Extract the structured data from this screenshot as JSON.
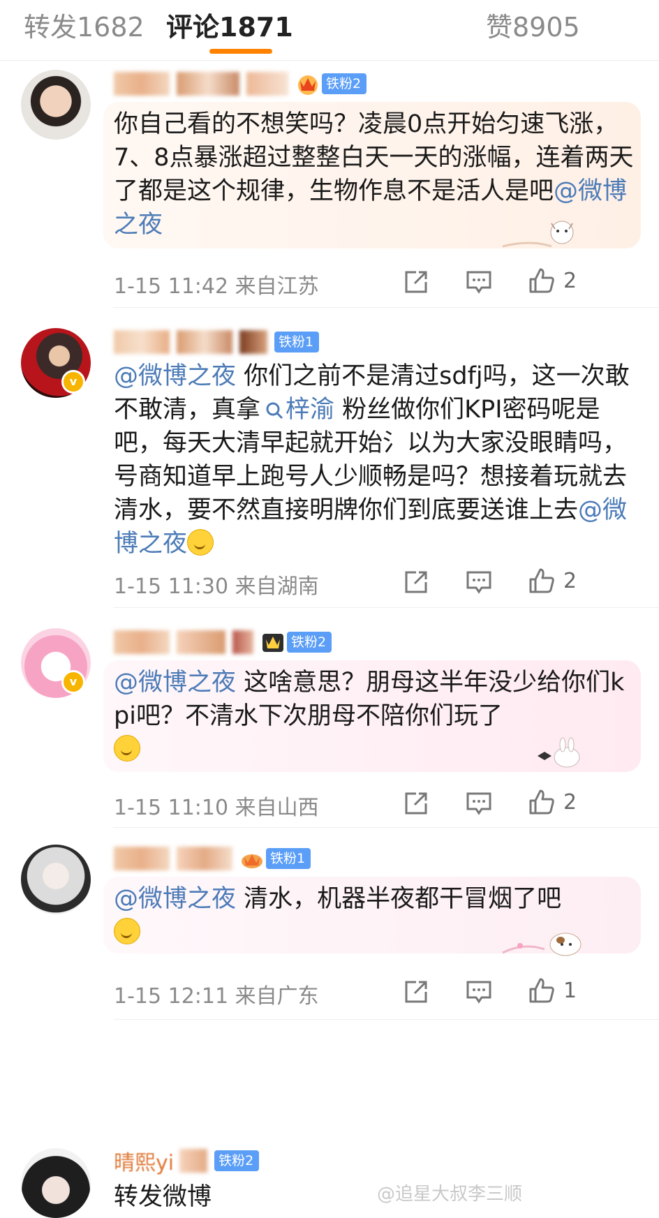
{
  "tabs": {
    "repost": "转发1682",
    "comments": "评论1871",
    "likes": "赞8905"
  },
  "colors": {
    "accent": "#ff8200",
    "mention": "#4c7bb7",
    "fan_badge": "#5b9ef7",
    "vip": "#f7b500"
  },
  "comments": [
    {
      "fan_badge": "铁粉2",
      "text": "你自己看的不想笑吗？凌晨0点开始匀速飞涨，7、8点暴涨超过整整白天一天的涨幅，连着两天了都是这个规律，生物作息不是活人是吧",
      "mention_end": "@微博之夜",
      "time": "1-15 11:42",
      "location": "来自江苏",
      "likes": "2"
    },
    {
      "fan_badge": "铁粉1",
      "mention_start": "@微博之夜",
      "text_a": " 你们之前不是清过sdfj吗，这一次敢不敢清，真拿",
      "search_link": "梓渝",
      "text_b": " 粉丝做你们KPI密码呢是吧，每天大清早起就开始氵以为大家没眼睛吗，号商知道早上跑号人少顺畅是吗？想接着玩就去清水，要不然直接明牌你们到底要送谁上去",
      "mention_end": "@微博之夜",
      "time": "1-15 11:30",
      "location": "来自湖南",
      "likes": "2"
    },
    {
      "fan_badge": "铁粉2",
      "mention_start": "@微博之夜",
      "text": "  这啥意思？朋母这半年没少给你们kpi吧？不清水下次朋母不陪你们玩了",
      "time": "1-15 11:10",
      "location": "来自山西",
      "likes": "2"
    },
    {
      "fan_badge": "铁粉1",
      "mention_start": "@微博之夜",
      "text": " 清水，机器半夜都干冒烟了吧",
      "time": "1-15 12:11",
      "location": "来自广东",
      "likes": "1"
    },
    {
      "name_visible": "晴熙yi",
      "fan_badge": "铁粉2",
      "text": "转发微博"
    }
  ],
  "watermark": "@追星大叔李三顺",
  "icons": [
    "share-icon",
    "comment-icon",
    "like-icon",
    "search-icon",
    "crown-icon",
    "vip-badge-icon",
    "smile-emoji-icon"
  ]
}
